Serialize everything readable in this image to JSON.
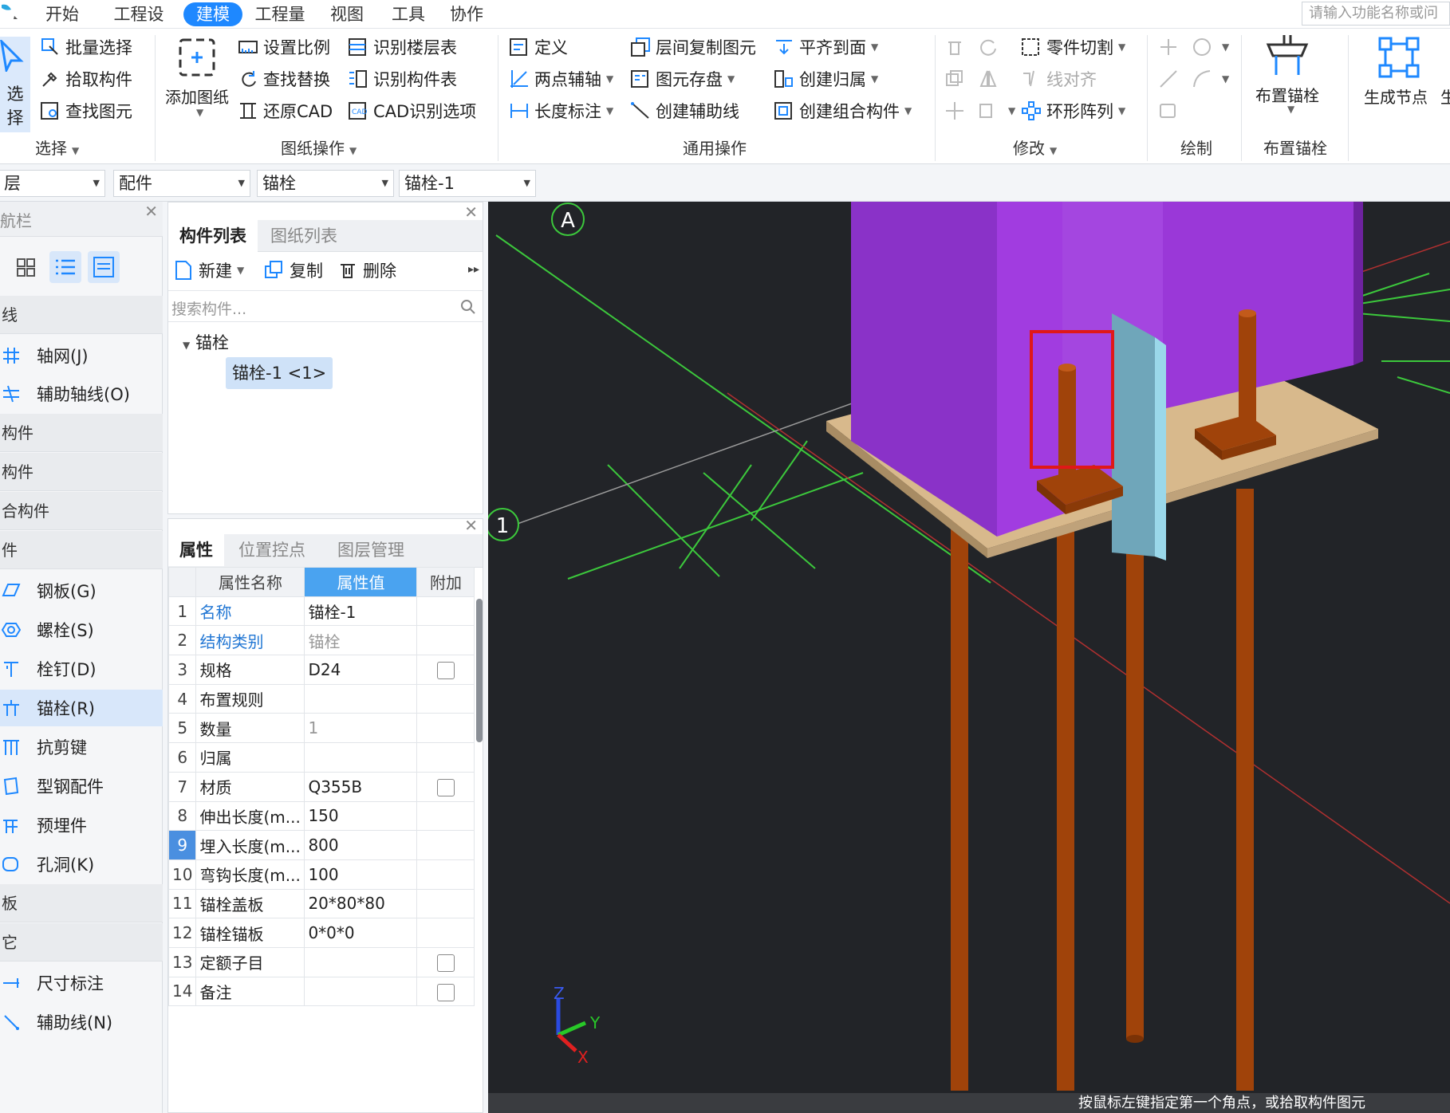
{
  "menubar": {
    "tabs": [
      "开始",
      "工程设置",
      "建模",
      "工程量",
      "视图",
      "工具",
      "协作"
    ],
    "active_tab": "建模",
    "search_placeholder": "请输入功能名称或问"
  },
  "ribbon": {
    "select_group": {
      "big_button": "选择",
      "items": [
        "批量选择",
        "拾取构件",
        "查找图元"
      ],
      "label": "选择"
    },
    "drawing_group": {
      "big_button": "添加图纸",
      "items": [
        "设置比例",
        "识别楼层表",
        "查找替换",
        "识别构件表",
        "还原CAD",
        "CAD识别选项"
      ],
      "label": "图纸操作"
    },
    "common_group": {
      "items": [
        "定义",
        "层间复制图元",
        "平齐到面",
        "两点辅轴",
        "图元存盘",
        "创建归属",
        "长度标注",
        "创建辅助线",
        "创建组合构件"
      ],
      "label": "通用操作"
    },
    "modify_group": {
      "items": [
        "零件切割",
        "线对齐",
        "环形阵列"
      ],
      "label": "修改"
    },
    "draw_group": {
      "label": "绘制"
    },
    "anchor_group": {
      "big_button": "布置锚栓",
      "label": "布置锚栓"
    },
    "node_group": {
      "big_button": "生成节点",
      "cut_text": "生"
    }
  },
  "selectors": {
    "floor": "层",
    "category": "配件",
    "type": "锚栓",
    "component": "锚栓-1"
  },
  "nav": {
    "title": "航栏",
    "sections": [
      "线",
      "构件",
      "构件",
      "合构件",
      "件",
      "板",
      "它"
    ],
    "items": {
      "grid": "轴网(J)",
      "aux_grid": "辅助轴线(O)",
      "plate": "钢板(G)",
      "bolt": "螺栓(S)",
      "stud": "栓钉(D)",
      "anchor": "锚栓(R)",
      "shear_key": "抗剪键",
      "section_fitting": "型钢配件",
      "embedded": "预埋件",
      "hole": "孔洞(K)",
      "dimension": "尺寸标注",
      "aux_line": "辅助线(N)"
    }
  },
  "component_panel": {
    "tabs": [
      "构件列表",
      "图纸列表"
    ],
    "toolbar": {
      "new": "新建",
      "copy": "复制",
      "delete": "删除"
    },
    "search_placeholder": "搜索构件...",
    "tree": {
      "group": "锚栓",
      "item": "锚栓-1 <1>"
    }
  },
  "property_panel": {
    "tabs": [
      "属性",
      "位置控点",
      "图层管理"
    ],
    "headers": [
      "属性名称",
      "属性值",
      "附加"
    ],
    "rows": [
      {
        "no": "1",
        "name": "名称",
        "value": "锚栓-1",
        "link": true,
        "gray": false,
        "checkbox": false
      },
      {
        "no": "2",
        "name": "结构类别",
        "value": "锚栓",
        "link": true,
        "gray": true,
        "checkbox": false
      },
      {
        "no": "3",
        "name": "规格",
        "value": "D24",
        "link": false,
        "gray": false,
        "checkbox": true
      },
      {
        "no": "4",
        "name": "布置规则",
        "value": "",
        "link": false,
        "gray": false,
        "checkbox": false
      },
      {
        "no": "5",
        "name": "数量",
        "value": "1",
        "link": false,
        "gray": true,
        "checkbox": false
      },
      {
        "no": "6",
        "name": "归属",
        "value": "",
        "link": false,
        "gray": false,
        "checkbox": false
      },
      {
        "no": "7",
        "name": "材质",
        "value": "Q355B",
        "link": false,
        "gray": false,
        "checkbox": true
      },
      {
        "no": "8",
        "name": "伸出长度(m...",
        "value": "150",
        "link": false,
        "gray": false,
        "checkbox": false
      },
      {
        "no": "9",
        "name": "埋入长度(m...",
        "value": "800",
        "link": false,
        "gray": false,
        "checkbox": false
      },
      {
        "no": "10",
        "name": "弯钩长度(m...",
        "value": "100",
        "link": false,
        "gray": false,
        "checkbox": false
      },
      {
        "no": "11",
        "name": "锚栓盖板",
        "value": "20*80*80",
        "link": false,
        "gray": false,
        "checkbox": false
      },
      {
        "no": "12",
        "name": "锚栓锚板",
        "value": "0*0*0",
        "link": false,
        "gray": false,
        "checkbox": false
      },
      {
        "no": "13",
        "name": "定额子目",
        "value": "",
        "link": false,
        "gray": false,
        "checkbox": true
      },
      {
        "no": "14",
        "name": "备注",
        "value": "",
        "link": false,
        "gray": false,
        "checkbox": true
      }
    ],
    "selected_row": "9"
  },
  "viewport": {
    "axis_a": "A",
    "axis_1": "1",
    "triad": {
      "x": "X",
      "y": "Y",
      "z": "Z"
    },
    "status_text": "按鼠标左键指定第一个角点，或拾取构件图元"
  },
  "colors": {
    "accent": "#1e88ff",
    "column": "#a13ce0",
    "bolt": "#a0430a",
    "base_plate": "#d8b98c",
    "viewport_bg": "#222428",
    "highlight": "#e01818"
  }
}
